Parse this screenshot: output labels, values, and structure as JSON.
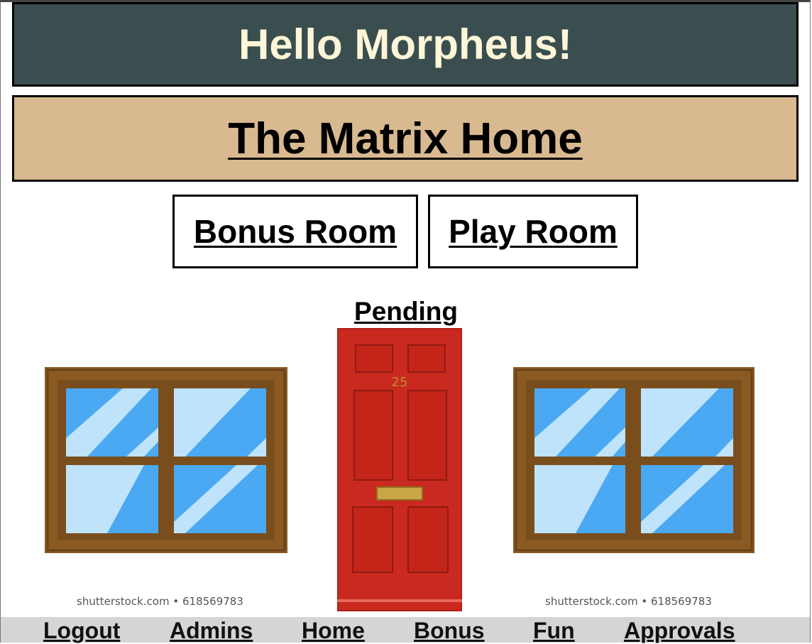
{
  "header": {
    "greeting": "Hello Morpheus!"
  },
  "banner": {
    "title": "The Matrix Home"
  },
  "rooms": [
    {
      "label": "Bonus Room"
    },
    {
      "label": "Play Room"
    }
  ],
  "door": {
    "status": "Pending",
    "number": "25"
  },
  "watermarks": {
    "left": "shutterstock.com • 618569783",
    "right": "shutterstock.com • 618569783"
  },
  "nav": {
    "items": [
      {
        "label": "Logout"
      },
      {
        "label": "Admins"
      },
      {
        "label": "Home"
      },
      {
        "label": "Bonus"
      },
      {
        "label": "Fun"
      },
      {
        "label": "Approvals"
      }
    ]
  },
  "colors": {
    "header_bg": "#3a4e4f",
    "header_text": "#fdf6d8",
    "banner_bg": "#d8b990",
    "door_red": "#c9291f",
    "window_frame": "#8a5a22",
    "glass_blue": "#4aa9f2",
    "nav_bg": "#d5d5d5"
  }
}
